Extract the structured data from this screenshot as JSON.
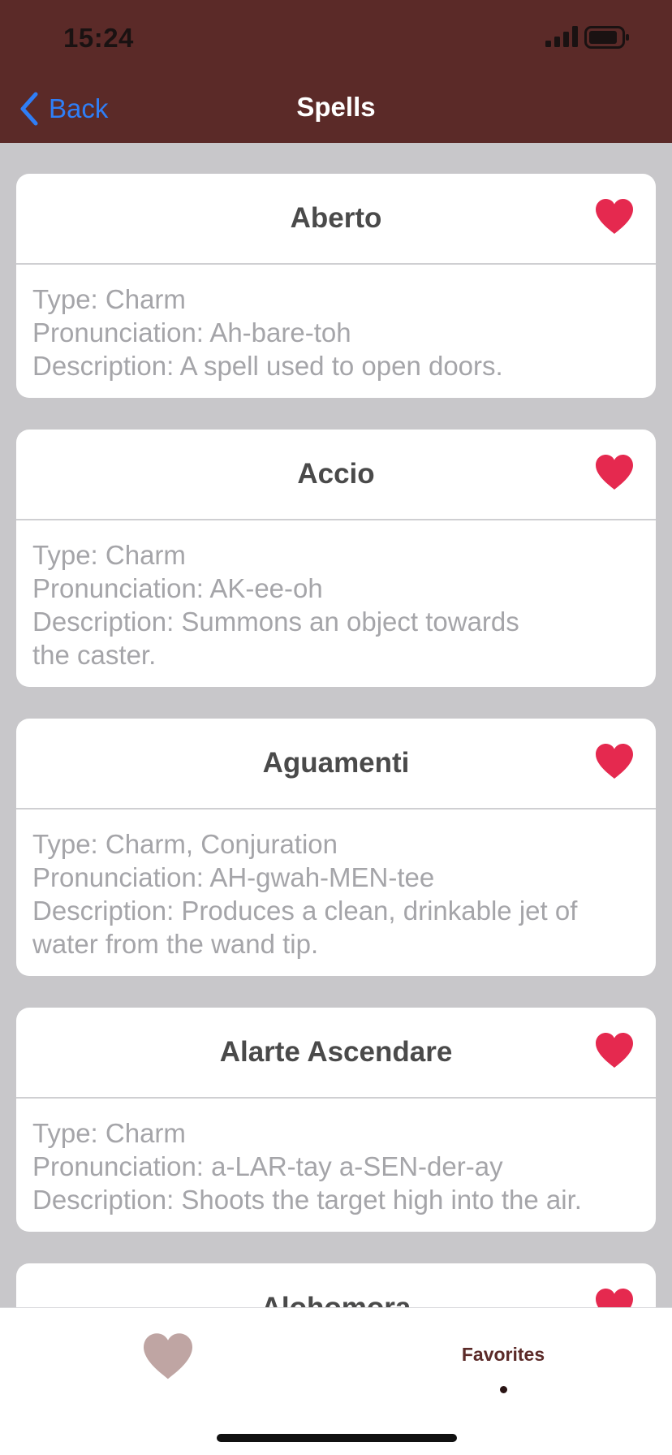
{
  "status_bar": {
    "time": "15:24"
  },
  "nav": {
    "back_label": "Back",
    "title": "Spells"
  },
  "colors": {
    "header_bg": "#5b2a28",
    "back_link": "#2f7ef6",
    "heart_favorite": "#e5294f",
    "tab_heart": "#bfa5a3",
    "list_bg": "#c8c7ca"
  },
  "spells": [
    {
      "name": "Aberto",
      "type": "Type: Charm",
      "pronunciation": "Pronunciation: Ah-bare-toh",
      "description": "Description: A spell used to open doors.",
      "favorite_icon": "heart-icon"
    },
    {
      "name": "Accio",
      "type": "Type: Charm",
      "pronunciation": "Pronunciation: AK-ee-oh",
      "description": "Description: Summons an object towards the caster.",
      "favorite_icon": "heart-icon"
    },
    {
      "name": "Aguamenti",
      "type": "Type: Charm, Conjuration",
      "pronunciation": "Pronunciation: AH-gwah-MEN-tee",
      "description": "Description: Produces a clean, drinkable jet of water from the wand tip.",
      "favorite_icon": "heart-icon"
    },
    {
      "name": "Alarte Ascendare",
      "type": "Type: Charm",
      "pronunciation": "Pronunciation: a-LAR-tay a-SEN-der-ay",
      "description": "Description: Shoots the target high into the air.",
      "favorite_icon": "heart-icon"
    },
    {
      "name": "Alohomora",
      "favorite_icon": "heart-icon"
    }
  ],
  "tab_bar": {
    "left_icon": "heart-icon",
    "favorites_label": "Favorites"
  }
}
